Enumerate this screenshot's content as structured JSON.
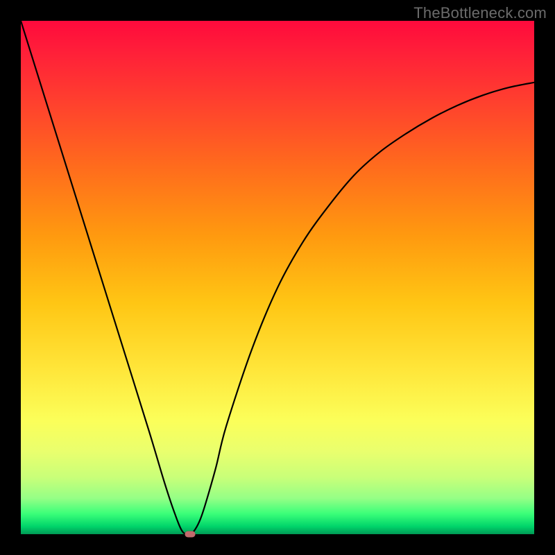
{
  "watermark": "TheBottleneck.com",
  "colors": {
    "page_background": "#000000",
    "curve_stroke": "#000000",
    "marker_fill": "#c06a6c",
    "gradient_top": "#ff0a3c",
    "gradient_bottom": "#009a55"
  },
  "chart_data": {
    "type": "line",
    "title": "",
    "xlabel": "",
    "ylabel": "",
    "xlim": [
      0,
      100
    ],
    "ylim": [
      0,
      100
    ],
    "annotations": [
      {
        "text": "TheBottleneck.com",
        "position": "top-right"
      }
    ],
    "series": [
      {
        "name": "bottleneck-curve",
        "x": [
          0,
          5,
          10,
          15,
          20,
          25,
          28,
          30,
          31.5,
          33,
          34,
          35,
          36,
          38,
          40,
          45,
          50,
          55,
          60,
          65,
          70,
          75,
          80,
          85,
          90,
          95,
          100
        ],
        "values": [
          100,
          84,
          68,
          52,
          36,
          20,
          10,
          4,
          0.5,
          0,
          1,
          3,
          6,
          13,
          21,
          36,
          48,
          57,
          64,
          70,
          74.5,
          78,
          81,
          83.5,
          85.5,
          87,
          88
        ]
      }
    ],
    "marker": {
      "name": "minimum-point",
      "x": 33,
      "y": 0
    },
    "background": {
      "type": "linear-gradient",
      "direction": "top-to-bottom",
      "stops": [
        {
          "pos": 0,
          "color": "#ff0a3c"
        },
        {
          "pos": 0.15,
          "color": "#ff3d2f"
        },
        {
          "pos": 0.42,
          "color": "#ff9a0f"
        },
        {
          "pos": 0.68,
          "color": "#ffe63a"
        },
        {
          "pos": 0.84,
          "color": "#e9ff6e"
        },
        {
          "pos": 0.96,
          "color": "#3bff79"
        },
        {
          "pos": 1.0,
          "color": "#009a55"
        }
      ]
    }
  }
}
